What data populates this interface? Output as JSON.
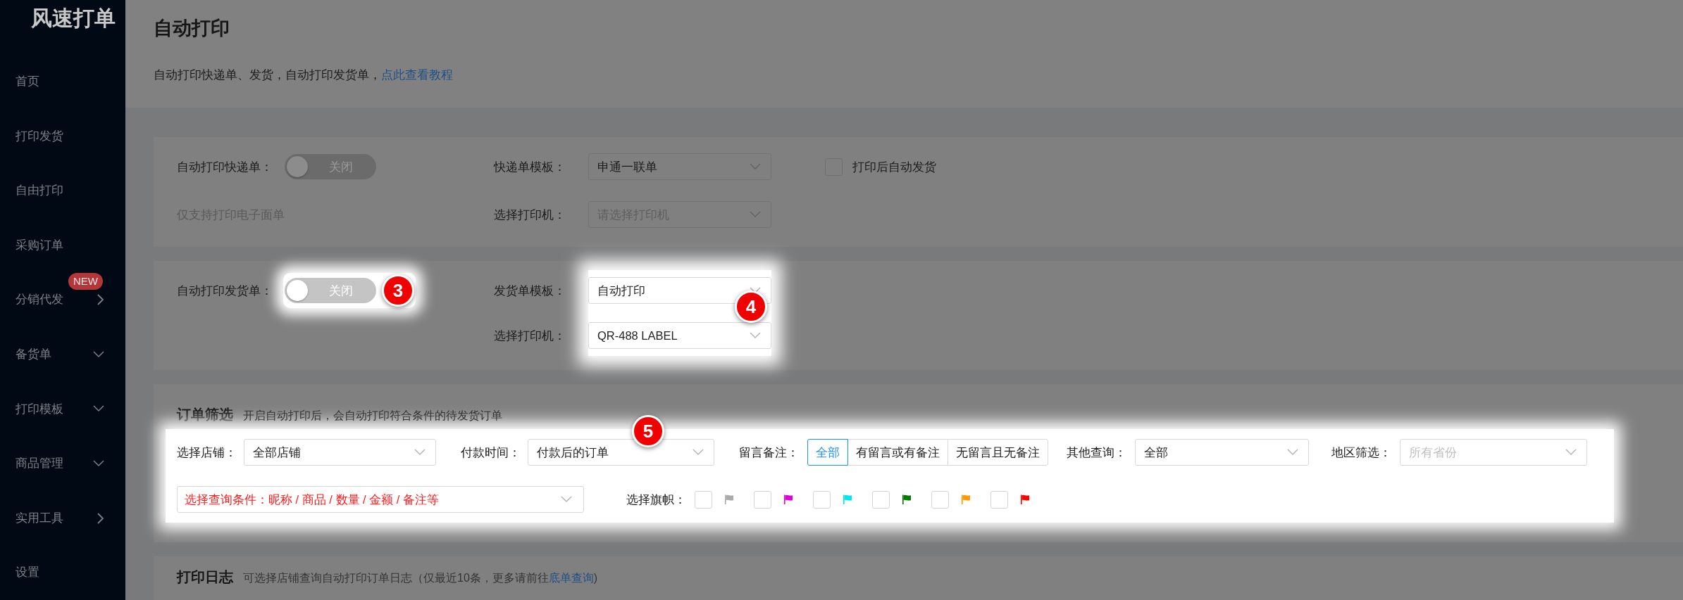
{
  "sidebar": {
    "logo": "风速打单",
    "items": [
      {
        "label": "首页",
        "kind": "link"
      },
      {
        "label": "打印发货",
        "kind": "link"
      },
      {
        "label": "自由打印",
        "kind": "link"
      },
      {
        "label": "采购订单",
        "kind": "link"
      },
      {
        "label": "分销代发",
        "badge": "NEW",
        "kind": "submenu"
      },
      {
        "label": "备货单",
        "kind": "dropdown"
      },
      {
        "label": "打印模板",
        "kind": "dropdown"
      },
      {
        "label": "商品管理",
        "kind": "dropdown"
      },
      {
        "label": "实用工具",
        "kind": "submenu"
      },
      {
        "label": "设置",
        "kind": "link"
      }
    ]
  },
  "header": {
    "title": "自动打印",
    "description": "自动打印快递单、发货，自动打印发货单，",
    "link": "点此查看教程"
  },
  "express_card": {
    "toggle": {
      "label": "自动打印快递单：",
      "state_text": "关闭",
      "on": false
    },
    "note": "仅支持打印电子面单",
    "template": {
      "label": "快递单模板：",
      "value": "申通一联单"
    },
    "printer": {
      "label": "选择打印机：",
      "placeholder": "请选择打印机"
    },
    "auto_ship": {
      "label": "打印后自动发货",
      "checked": false
    }
  },
  "invoice_card": {
    "toggle": {
      "label": "自动打印发货单：",
      "state_text": "关闭",
      "on": false,
      "marker": "3"
    },
    "marker": "4",
    "template": {
      "label": "发货单模板：",
      "value": "自动打印"
    },
    "printer": {
      "label": "选择打印机：",
      "value": "QR-488 LABEL"
    }
  },
  "order_filter": {
    "title": "订单筛选",
    "description": "开启自动打印后，会自动打印符合条件的待发货订单",
    "marker": "5",
    "store": {
      "label": "选择店铺：",
      "value": "全部店铺"
    },
    "pay_time": {
      "label": "付款时间：",
      "value": "付款后的订单"
    },
    "remark": {
      "label": "留言备注：",
      "options": [
        {
          "label": "全部",
          "selected": true
        },
        {
          "label": "有留言或有备注",
          "selected": false
        },
        {
          "label": "无留言且无备注",
          "selected": false
        }
      ]
    },
    "other": {
      "label": "其他查询：",
      "value": "全部"
    },
    "region": {
      "label": "地区筛选：",
      "placeholder": "所有省份"
    },
    "condition": {
      "prompt": "选择查询条件：昵称 / 商品 / 数量 / 金额 / 备注等"
    },
    "flags": {
      "label": "选择旗帜：",
      "items": [
        {
          "color": "#aaaaaa",
          "checked": false
        },
        {
          "color": "#dd00dd",
          "checked": false
        },
        {
          "color": "#00e5ee",
          "checked": false
        },
        {
          "color": "#007a00",
          "checked": false
        },
        {
          "color": "#ff9900",
          "checked": false
        },
        {
          "color": "#ff0000",
          "checked": false
        }
      ]
    }
  },
  "print_log": {
    "title": "打印日志",
    "description": "可选择店铺查询自动打印订单日志（仅最近10条，更多请前往",
    "link": "底单查询",
    "description_end": ")"
  }
}
